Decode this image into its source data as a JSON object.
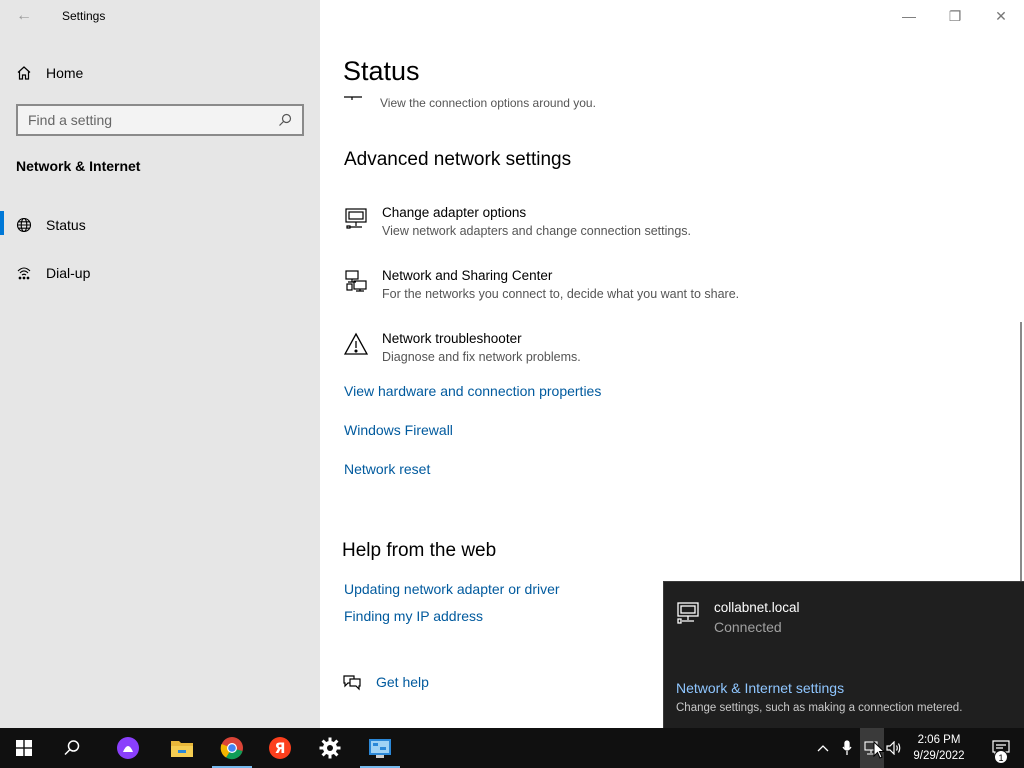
{
  "window": {
    "app_title": "Settings",
    "controls": {
      "minimize": "—",
      "maximize": "❐",
      "close": "✕"
    }
  },
  "sidebar": {
    "home_label": "Home",
    "search_placeholder": "Find a setting",
    "section_label": "Network & Internet",
    "items": [
      {
        "label": "Status",
        "icon": "globe-icon",
        "active": true
      },
      {
        "label": "Dial-up",
        "icon": "dialup-icon",
        "active": false
      }
    ]
  },
  "main": {
    "title": "Status",
    "partial_desc": "View the connection options around you.",
    "advanced_heading": "Advanced network settings",
    "advanced_items": [
      {
        "title": "Change adapter options",
        "desc": "View network adapters and change connection settings.",
        "icon": "adapter-icon"
      },
      {
        "title": "Network and Sharing Center",
        "desc": "For the networks you connect to, decide what you want to share.",
        "icon": "sharing-center-icon"
      },
      {
        "title": "Network troubleshooter",
        "desc": "Diagnose and fix network problems.",
        "icon": "warning-icon"
      }
    ],
    "links": {
      "hardware": "View hardware and connection properties",
      "firewall": "Windows Firewall",
      "reset": "Network reset"
    },
    "help_heading": "Help from the web",
    "help_links": {
      "update_driver": "Updating network adapter or driver",
      "find_ip": "Finding my IP address"
    },
    "get_help": "Get help"
  },
  "flyout": {
    "network_name": "collabnet.local",
    "network_status": "Connected",
    "settings_link": "Network & Internet settings",
    "settings_desc": "Change settings, such as making a connection metered."
  },
  "taskbar": {
    "apps": [
      "start-icon",
      "search-icon",
      "alice-icon",
      "file-explorer-icon",
      "chrome-icon",
      "yandex-icon",
      "settings-gear-icon",
      "control-panel-icon"
    ],
    "time": "2:06 PM",
    "date": "9/29/2022",
    "notification_count": "1"
  },
  "colors": {
    "accent": "#0078d7",
    "link": "#005a9e",
    "flyout_bg": "#1f1f1f",
    "taskbar_bg": "#101010"
  }
}
